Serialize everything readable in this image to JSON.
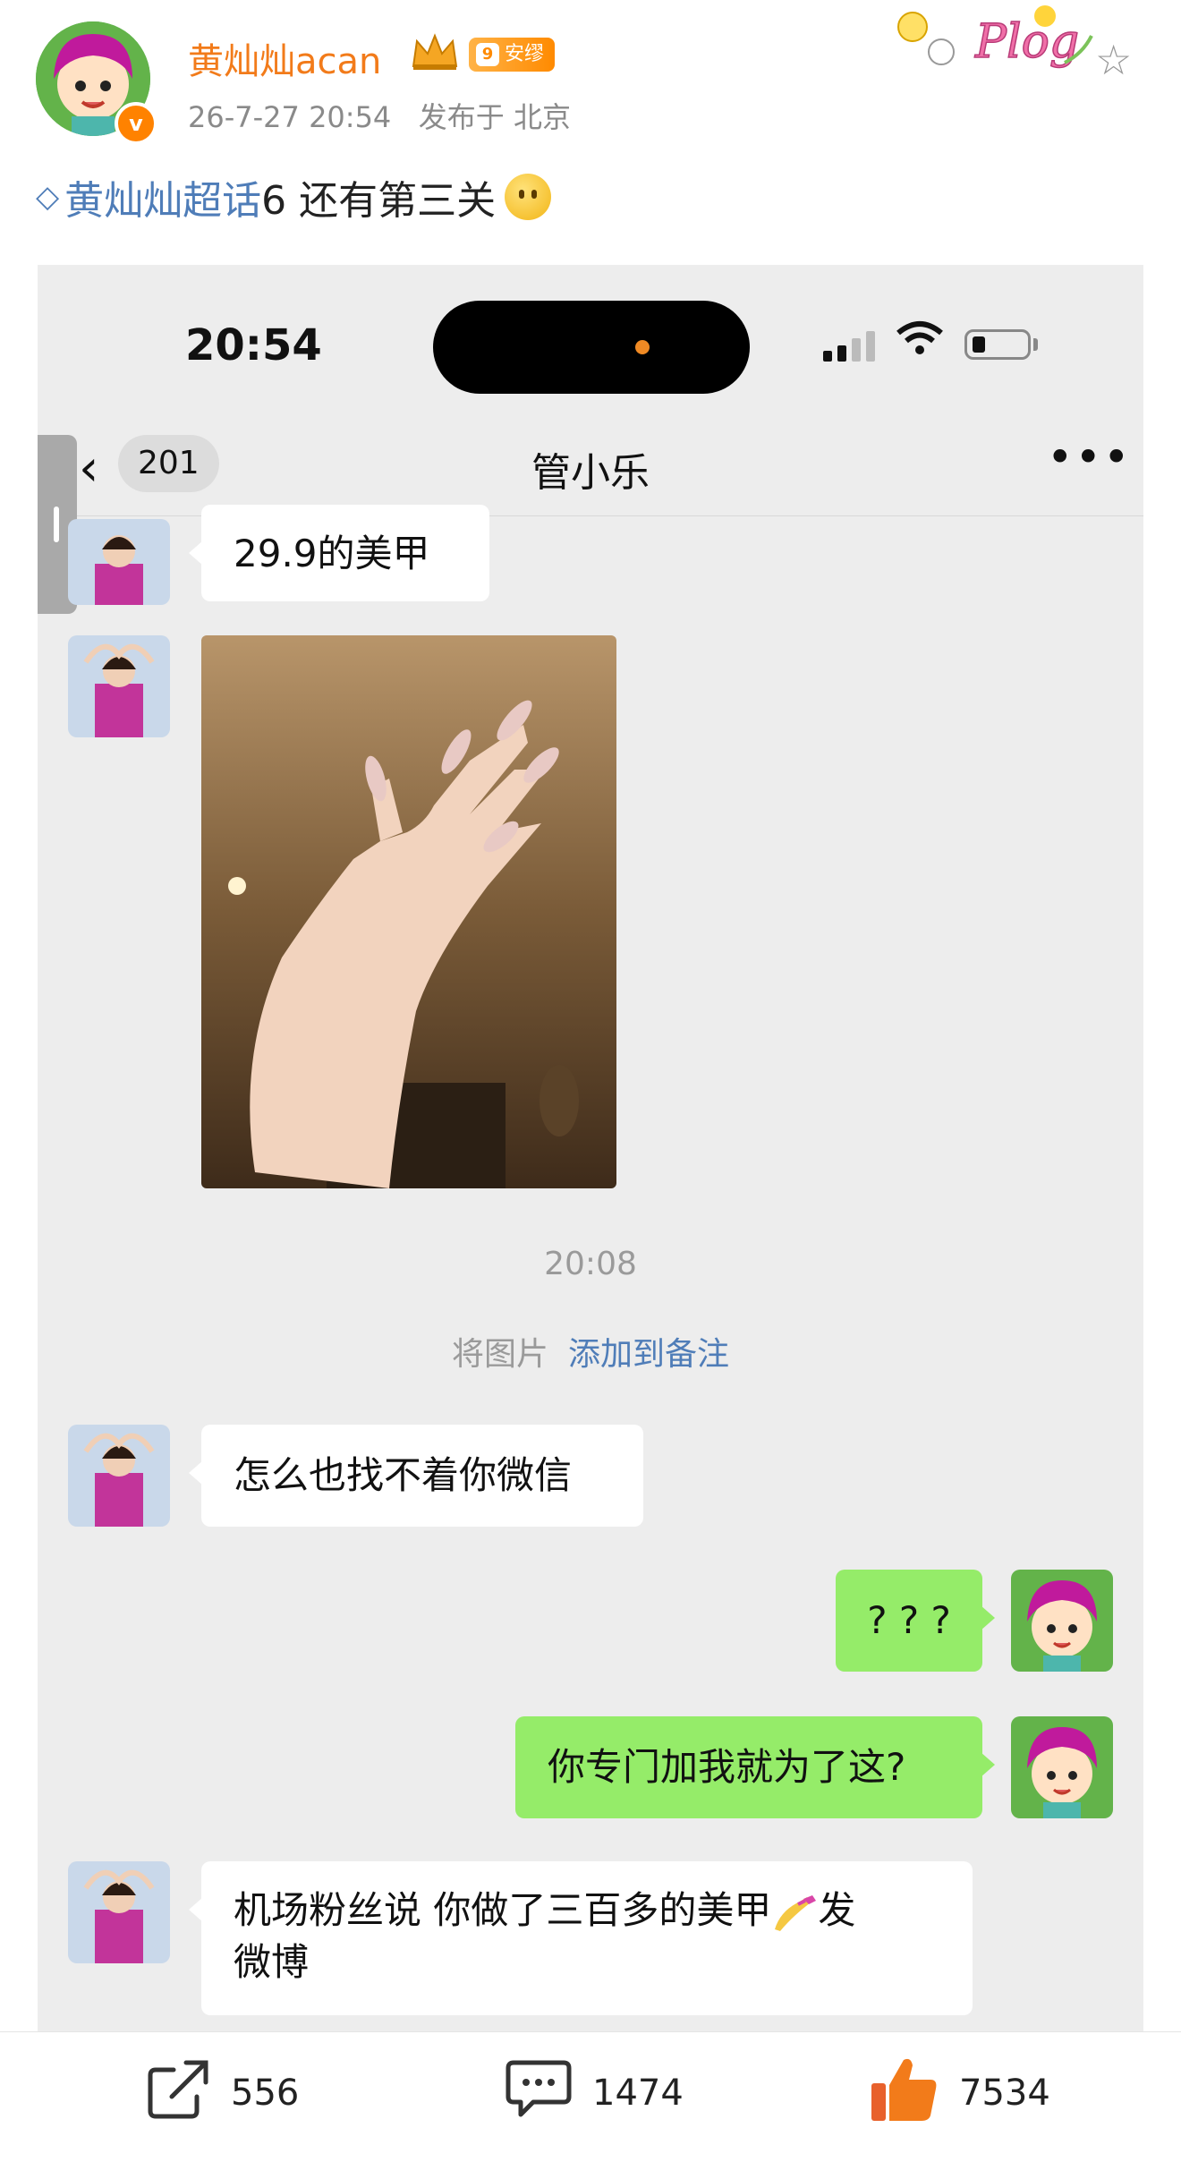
{
  "post": {
    "username": "黄灿灿acan",
    "fan_badge": {
      "level": "9",
      "label": "安缪"
    },
    "time": "26-7-27 20:54",
    "location": "发布于 北京",
    "topic": "黄灿灿超话",
    "text": " 6 还有第三关"
  },
  "screenshot": {
    "status_time": "20:54",
    "chat": {
      "unread_count": "201",
      "title": "管小乐",
      "timestamp": "20:08",
      "system_note": {
        "text": "将图片",
        "link": "添加到备注"
      },
      "messages": [
        {
          "side": "left",
          "text": "29.9的美甲"
        },
        {
          "side": "left",
          "type": "image"
        },
        {
          "side": "left",
          "text": "怎么也找不着你微信"
        },
        {
          "side": "right",
          "text": "? ? ?"
        },
        {
          "side": "right",
          "text": "你专门加我就为了这?"
        },
        {
          "side": "left",
          "text_line1": "机场粉丝说 你做了三百多的美甲",
          "text_line1_end": "发",
          "text_line2": "微博"
        }
      ]
    }
  },
  "toolbar": {
    "reposts": "556",
    "comments": "1474",
    "likes": "7534"
  },
  "colors": {
    "username": "#f27b1a",
    "topic_link": "#4f7db8",
    "wechat_green": "#95ec69",
    "like_orange": "#f27b1a"
  }
}
